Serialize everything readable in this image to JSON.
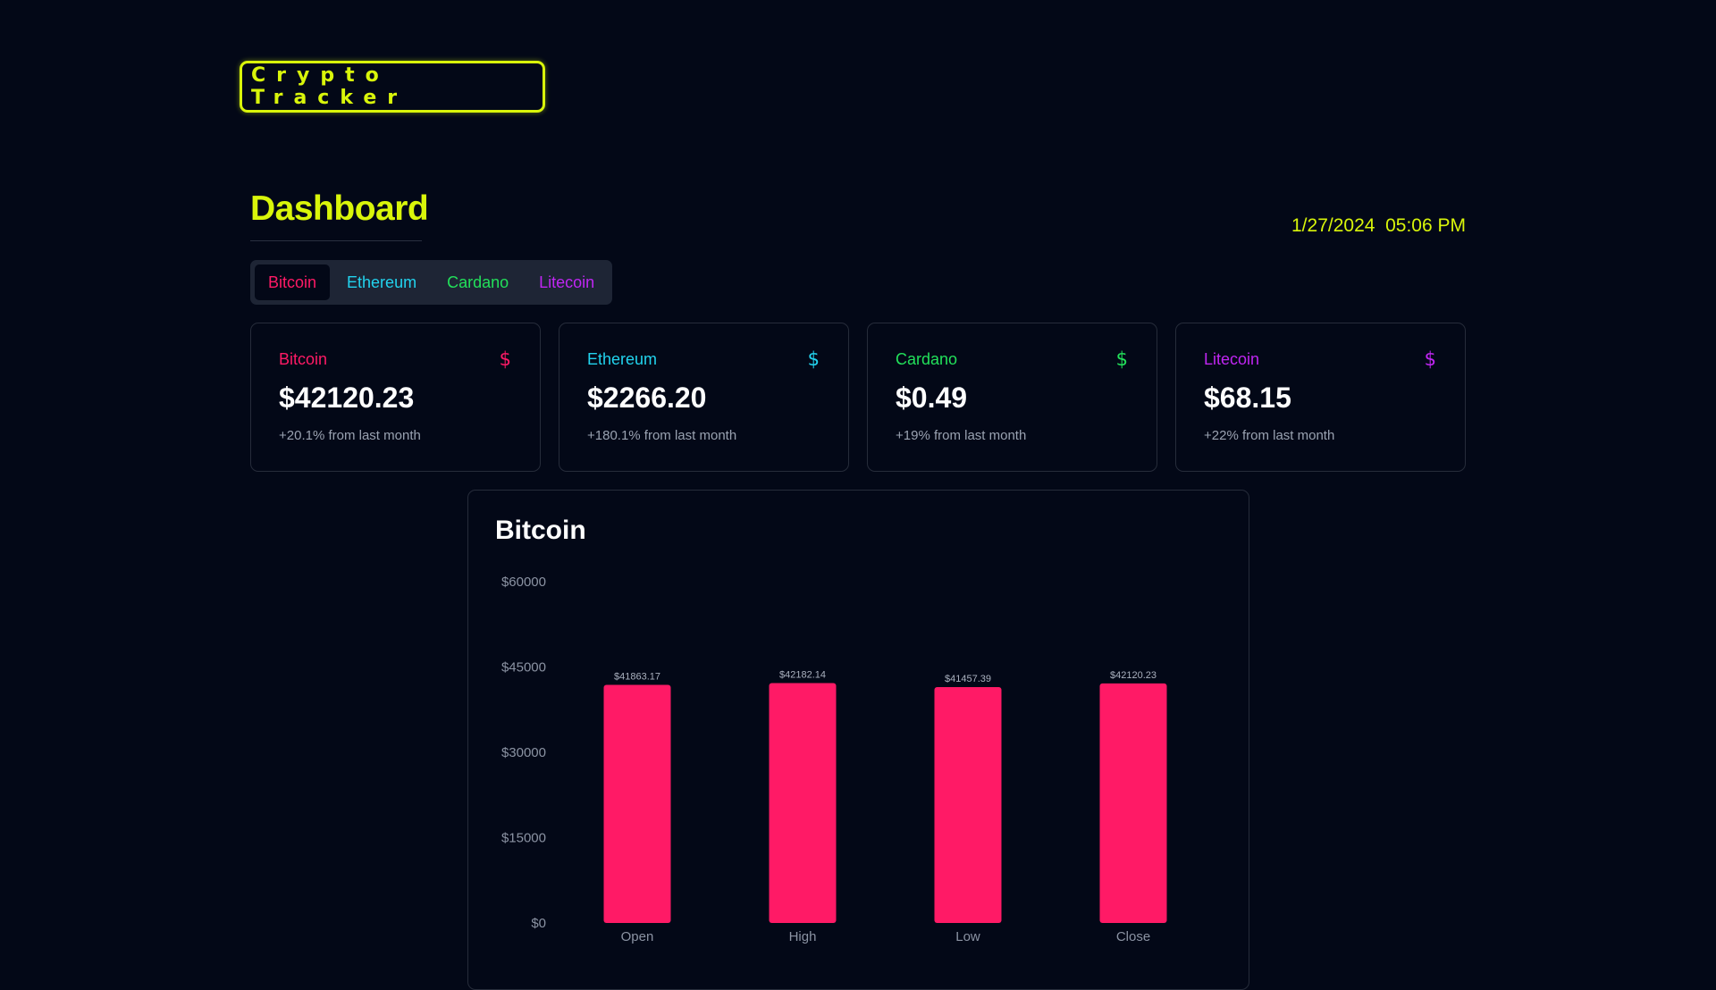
{
  "logo": {
    "text": "Crypto Tracker"
  },
  "header": {
    "title": "Dashboard",
    "date": "1/27/2024",
    "time": "05:06 PM"
  },
  "tabs": [
    {
      "label": "Bitcoin",
      "color": "#ff1a66",
      "active": true
    },
    {
      "label": "Ethereum",
      "color": "#22d3ee",
      "active": false
    },
    {
      "label": "Cardano",
      "color": "#22e05a",
      "active": false
    },
    {
      "label": "Litecoin",
      "color": "#c026f3",
      "active": false
    }
  ],
  "cards": [
    {
      "name": "Bitcoin",
      "icon": "dollar-icon",
      "icon_char": "$",
      "price": "$42120.23",
      "change": "+20.1% from last month",
      "color": "#ff1a66"
    },
    {
      "name": "Ethereum",
      "icon": "dollar-icon",
      "icon_char": "$",
      "price": "$2266.20",
      "change": "+180.1% from last month",
      "color": "#22d3ee"
    },
    {
      "name": "Cardano",
      "icon": "dollar-icon",
      "icon_char": "$",
      "price": "$0.49",
      "change": "+19% from last month",
      "color": "#22e05a"
    },
    {
      "name": "Litecoin",
      "icon": "dollar-icon",
      "icon_char": "$",
      "price": "$68.15",
      "change": "+22% from last month",
      "color": "#c026f3"
    }
  ],
  "chart_data": {
    "type": "bar",
    "title": "Bitcoin",
    "categories": [
      "Open",
      "High",
      "Low",
      "Close"
    ],
    "values": [
      41863.17,
      42182.14,
      41457.39,
      42120.23
    ],
    "value_labels": [
      "$41863.17",
      "$42182.14",
      "$41457.39",
      "$42120.23"
    ],
    "ylim": [
      0,
      60000
    ],
    "yticks": [
      0,
      15000,
      30000,
      45000,
      60000
    ],
    "ytick_labels": [
      "$0",
      "$15000",
      "$30000",
      "$45000",
      "$60000"
    ],
    "bar_color": "#ff1a66",
    "grid": false,
    "legend": "none"
  }
}
